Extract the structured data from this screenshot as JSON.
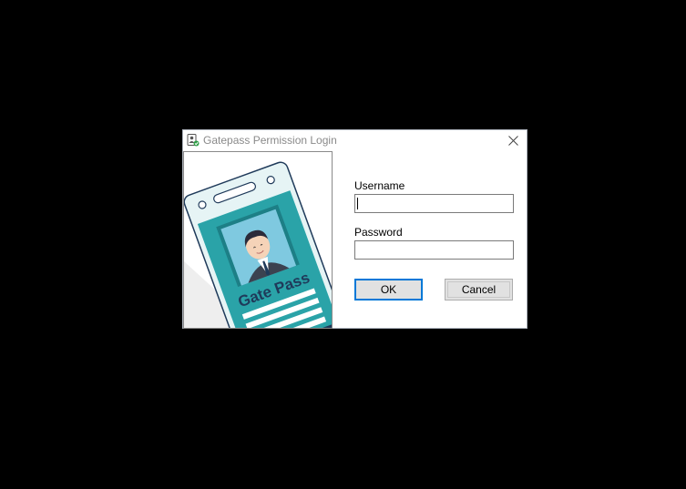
{
  "window": {
    "title": "Gatepass Permission Login",
    "icon": "badge-check-icon",
    "close_icon": "close-icon"
  },
  "image": {
    "badge_text": "Gate Pass",
    "colors": {
      "teal": "#2aa3a8",
      "dark_teal": "#1d7f86",
      "navy": "#1f3a5a"
    }
  },
  "form": {
    "username_label": "Username",
    "username_value": "",
    "password_label": "Password",
    "password_value": ""
  },
  "buttons": {
    "ok_label": "OK",
    "cancel_label": "Cancel"
  },
  "colors": {
    "background": "#000000",
    "focus_border": "#0078d7",
    "button_face": "#e1e1e1"
  }
}
